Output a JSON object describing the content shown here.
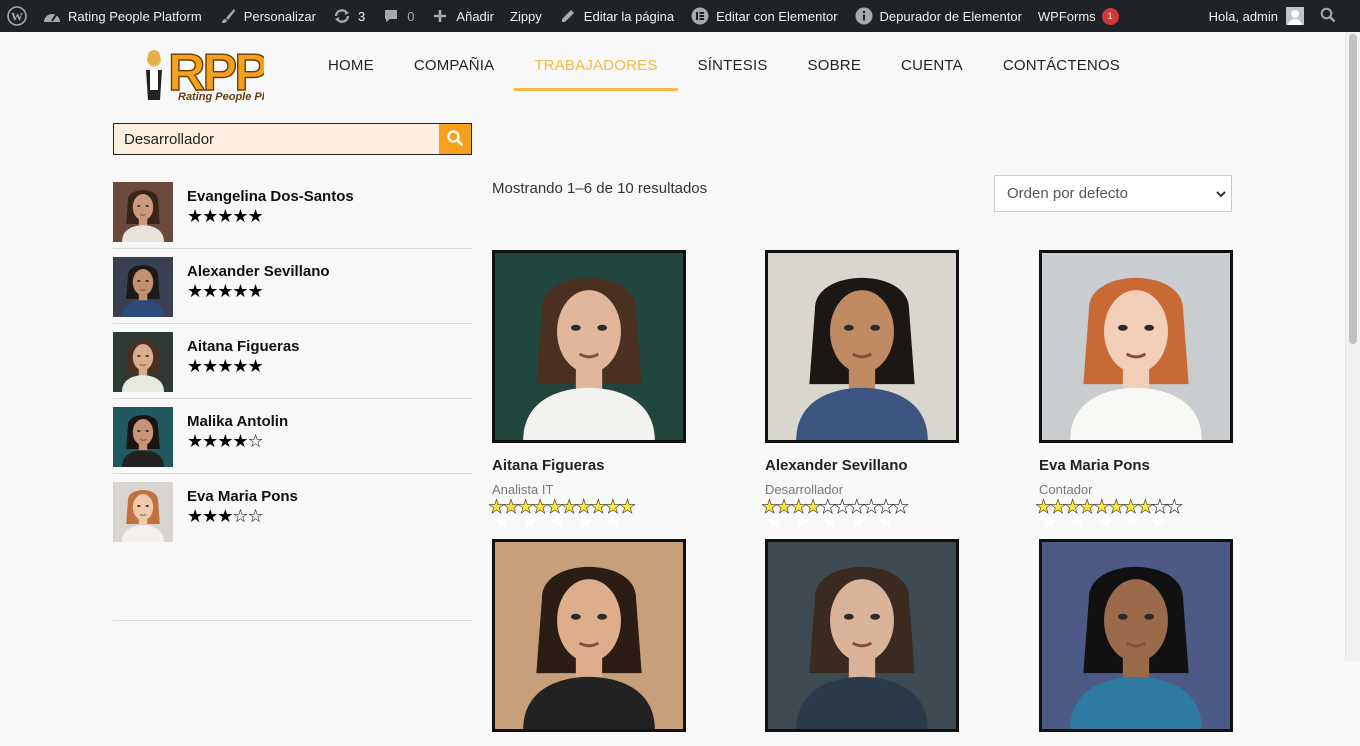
{
  "admin_bar": {
    "site_name": "Rating People Platform",
    "customize": "Personalizar",
    "updates_count": "3",
    "comments_count": "0",
    "add_new": "Añadir",
    "zippy": "Zippy",
    "edit_page": "Editar la página",
    "edit_elementor": "Editar con Elementor",
    "debugger": "Depurador de Elementor",
    "wpforms": "WPForms",
    "wpforms_badge": "1",
    "greeting": "Hola, admin"
  },
  "logo": {
    "letters": "RPP",
    "tagline": "Rating People Platform"
  },
  "nav": {
    "items": [
      {
        "label": "HOME"
      },
      {
        "label": "COMPAÑIA"
      },
      {
        "label": "TRABAJADORES"
      },
      {
        "label": "SÍNTESIS"
      },
      {
        "label": "SOBRE"
      },
      {
        "label": "CUENTA"
      },
      {
        "label": "CONTÁCTENOS"
      }
    ],
    "active_index": 2
  },
  "search": {
    "value": "Desarrollador"
  },
  "top_rated": [
    {
      "name": "Evangelina Dos-Santos",
      "rating": 5,
      "photo": "#6b4a3c"
    },
    {
      "name": "Alexander Sevillano",
      "rating": 5,
      "photo": "#3a3f52"
    },
    {
      "name": "Aitana Figueras",
      "rating": 5,
      "photo": "#2f3a35"
    },
    {
      "name": "Malika Antolin",
      "rating": 4,
      "photo": "#1f5a60"
    },
    {
      "name": "Eva Maria Pons",
      "rating": 3,
      "photo": "#d8d4cf"
    }
  ],
  "results": {
    "count_text": "Mostrando 1–6 de 10 resultados",
    "orderby": "Orden por defecto"
  },
  "products": [
    {
      "name": "Aitana Figueras",
      "category": "Analista IT",
      "rating": 10,
      "max": 10
    },
    {
      "name": "Alexander Sevillano",
      "category": "Desarrollador",
      "rating": 4,
      "max": 10
    },
    {
      "name": "Eva Maria Pons",
      "category": "Contador",
      "rating": 7.5,
      "max": 10
    },
    {
      "name": "",
      "category": "",
      "rating": 0,
      "max": 10
    },
    {
      "name": "",
      "category": "",
      "rating": 0,
      "max": 10
    },
    {
      "name": "",
      "category": "",
      "rating": 0,
      "max": 10
    }
  ]
}
